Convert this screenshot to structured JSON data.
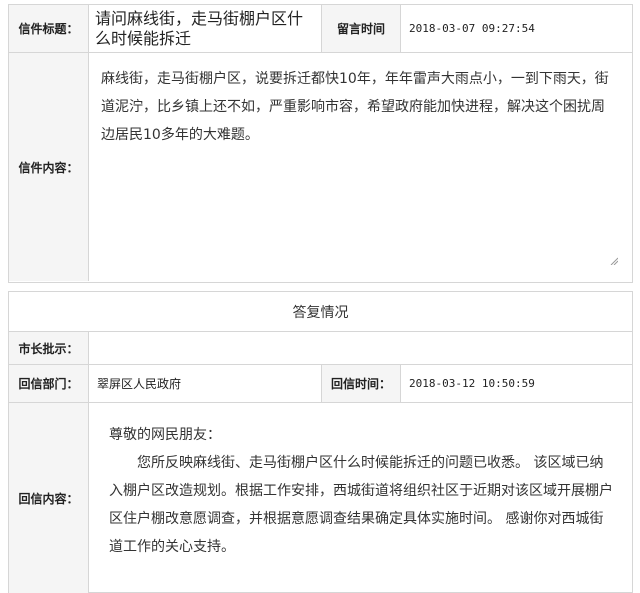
{
  "letter": {
    "title_label": "信件标题：",
    "title": "请问麻线街，走马街棚户区什么时候能拆迁",
    "time_label": "留言时间",
    "time": "2018-03-07 09:27:54",
    "content_label": "信件内容：",
    "content": "麻线街，走马街棚户区，说要拆迁都快10年，年年雷声大雨点小，一到下雨天，街道泥泞，比乡镇上还不如，严重影响市容，希望政府能加快进程，解决这个困扰周边居民10多年的大难题。"
  },
  "reply": {
    "section_title": "答复情况",
    "mayor_label": "市长批示：",
    "mayor_value": "",
    "dept_label": "回信部门：",
    "dept": "翠屏区人民政府",
    "time_label": "回信时间：",
    "time": "2018-03-12 10:50:59",
    "content_label": "回信内容：",
    "greeting": "尊敬的网民朋友：",
    "body": "您所反映麻线街、走马街棚户区什么时候能拆迁的问题已收悉。 该区域已纳入棚户区改造规划。根据工作安排，西城街道将组织社区于近期对该区域开展棚户区住户棚改意愿调查，并根据意愿调查结果确定具体实施时间。 感谢你对西城街道工作的关心支持。"
  }
}
